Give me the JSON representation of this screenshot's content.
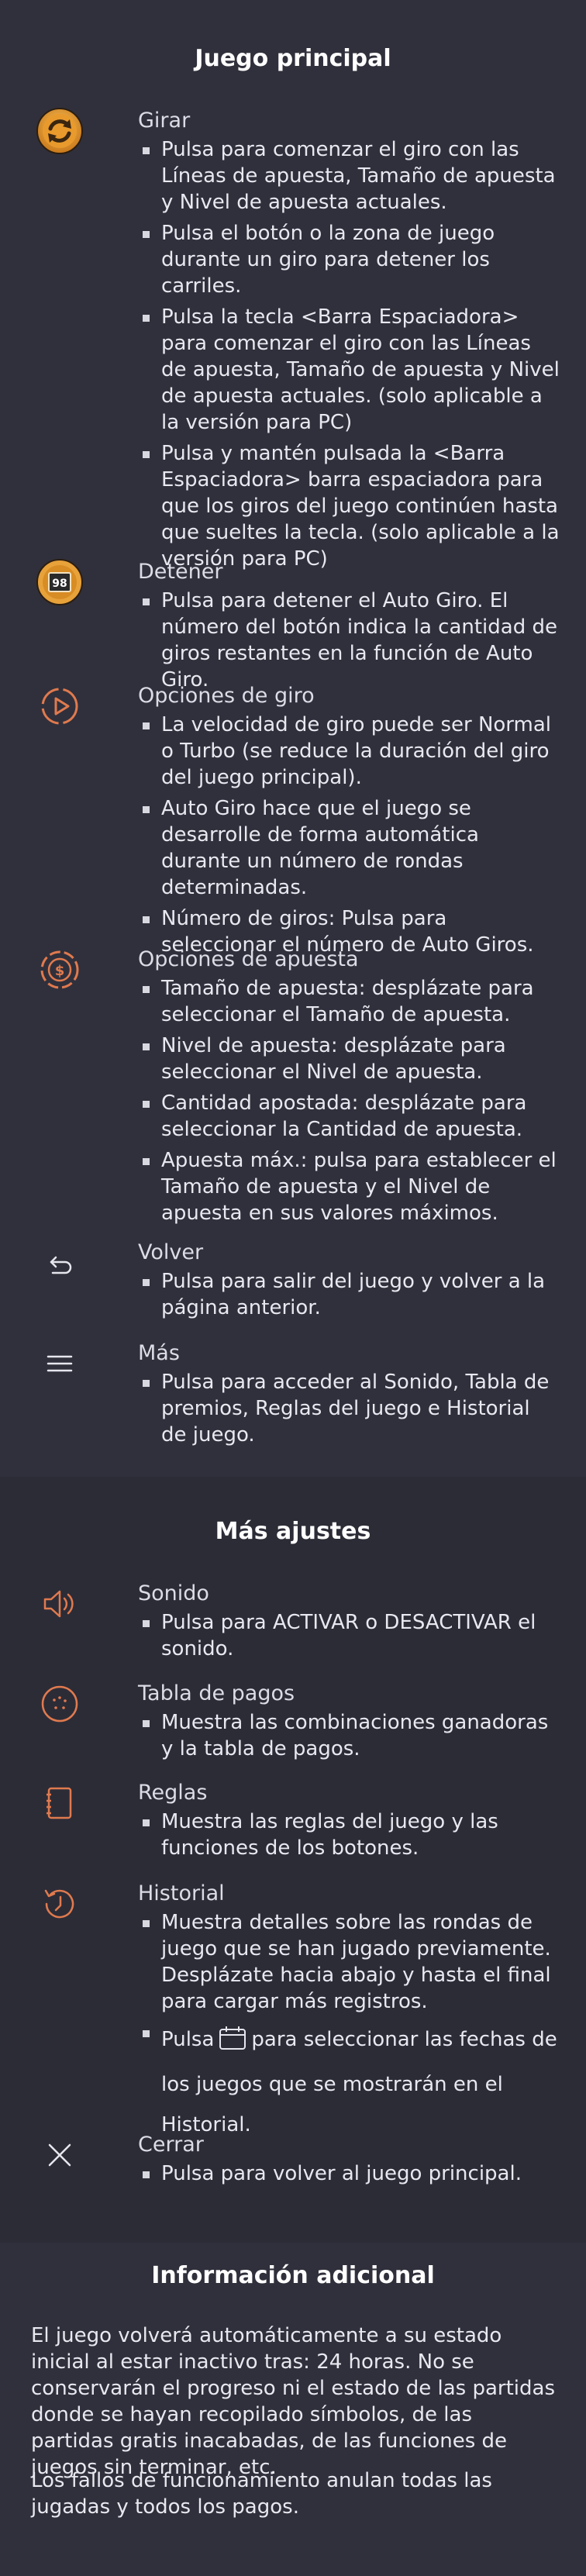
{
  "main": {
    "title": "Juego principal",
    "items": [
      {
        "icon": "spin-icon",
        "title": "Girar",
        "bullets": [
          "Pulsa para comenzar el giro con las Líneas de apuesta, Tamaño de apuesta y Nivel de apuesta actuales.",
          "Pulsa el botón o la zona de juego durante un giro para detener los carriles.",
          "Pulsa la tecla <Barra Espaciadora> para comenzar el giro con las Líneas de apuesta, Tamaño de apuesta y Nivel de apuesta actuales. (solo aplicable a la versión para PC)",
          "Pulsa y mantén pulsada la <Barra Espaciadora> barra espaciadora para que los giros del juego continúen hasta que sueltes la tecla. (solo aplicable a la versión para PC)"
        ]
      },
      {
        "icon": "stop-autospin-icon",
        "icon_text": "98",
        "title": "Detener",
        "bullets": [
          "Pulsa para detener el Auto Giro. El número del botón indica la cantidad de giros restantes en la función de Auto Giro."
        ]
      },
      {
        "icon": "spin-options-icon",
        "title": "Opciones de giro",
        "bullets": [
          "La velocidad de giro puede ser Normal o Turbo (se reduce la duración del giro del juego principal).",
          "Auto Giro hace que el juego se desarrolle de forma automática durante un número de rondas determinadas.",
          "Número de giros: Pulsa para seleccionar el número de Auto Giros."
        ]
      },
      {
        "icon": "bet-options-icon",
        "title": "Opciones de apuesta",
        "bullets": [
          "Tamaño de apuesta: desplázate para seleccionar el Tamaño de apuesta.",
          "Nivel de apuesta: desplázate para seleccionar el Nivel de apuesta.",
          "Cantidad apostada: desplázate para seleccionar la Cantidad de apuesta.",
          "Apuesta máx.: pulsa para establecer el Tamaño de apuesta y el Nivel de apuesta en sus valores máximos."
        ]
      },
      {
        "icon": "back-icon",
        "title": "Volver",
        "bullets": [
          "Pulsa para salir del juego y volver a la página anterior."
        ]
      },
      {
        "icon": "menu-icon",
        "title": "Más",
        "bullets": [
          "Pulsa para acceder al Sonido, Tabla de premios, Reglas del juego e Historial de juego."
        ]
      }
    ]
  },
  "more": {
    "title": "Más ajustes",
    "items": [
      {
        "icon": "sound-icon",
        "title": "Sonido",
        "bullets": [
          "Pulsa para ACTIVAR o DESACTIVAR el sonido."
        ]
      },
      {
        "icon": "paytable-icon",
        "title": "Tabla de pagos",
        "bullets": [
          "Muestra las combinaciones ganadoras y la tabla de pagos."
        ]
      },
      {
        "icon": "rules-icon",
        "title": "Reglas",
        "bullets": [
          "Muestra las reglas del juego y las funciones de los botones."
        ]
      },
      {
        "icon": "history-icon",
        "title": "Historial",
        "bullets": [
          "Muestra detalles sobre las rondas de juego que se han jugado previamente. Desplázate hacia abajo y hasta el final para cargar más registros."
        ],
        "calendar_before": "Pulsa",
        "calendar_icon": "calendar-icon",
        "calendar_after": "para seleccionar las fechas de los juegos que se mostrarán en el Historial."
      },
      {
        "icon": "close-icon",
        "title": "Cerrar",
        "bullets": [
          "Pulsa para volver al juego principal."
        ]
      }
    ]
  },
  "info": {
    "title": "Información adicional",
    "paragraph1": "El juego volverá automáticamente a su estado inicial al estar inactivo tras: 24 horas. No se conservarán el progreso ni el estado de las partidas donde se hayan recopilado símbolos, de las partidas gratis inacabadas, de las funciones de juegos sin terminar, etc.",
    "paragraph2": "Los fallos de funcionamiento anulan todas las jugadas y todos los pagos."
  },
  "colors": {
    "background": "#30303c",
    "accent_orange": "#e8a23a",
    "icon_line": "#e07a4e",
    "text": "#e8e8f0"
  }
}
